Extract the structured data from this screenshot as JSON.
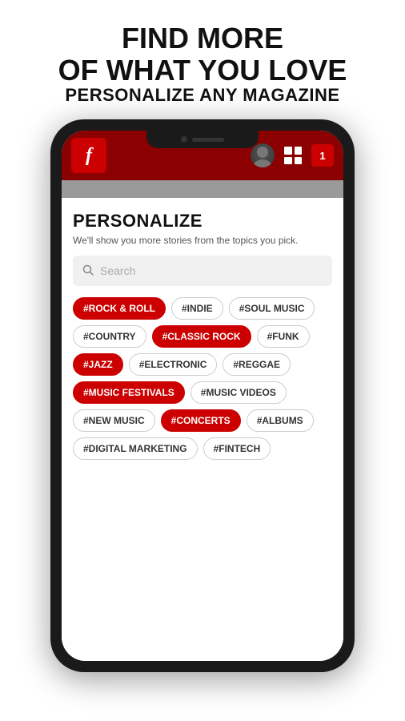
{
  "header": {
    "line1": "FIND MORE",
    "line2": "OF WHAT YOU LOVE",
    "line3": "PERSONALIZE ANY MAGAZINE"
  },
  "app": {
    "logo_letter": "f",
    "notification_count": "1"
  },
  "personalize": {
    "title": "PERSONALIZE",
    "subtitle": "We'll show you more stories from the topics you pick.",
    "search_placeholder": "Search"
  },
  "tags": [
    {
      "label": "#ROCK & ROLL",
      "active": true
    },
    {
      "label": "#INDIE",
      "active": false
    },
    {
      "label": "#SOUL MUSIC",
      "active": false
    },
    {
      "label": "#COUNTRY",
      "active": false
    },
    {
      "label": "#CLASSIC ROCK",
      "active": true
    },
    {
      "label": "#FUNK",
      "active": false
    },
    {
      "label": "#JAZZ",
      "active": true
    },
    {
      "label": "#ELECTRONIC",
      "active": false
    },
    {
      "label": "#REGGAE",
      "active": false
    },
    {
      "label": "#MUSIC FESTIVALS",
      "active": true
    },
    {
      "label": "#MUSIC VIDEOS",
      "active": false
    },
    {
      "label": "#NEW MUSIC",
      "active": false
    },
    {
      "label": "#CONCERTS",
      "active": true
    },
    {
      "label": "#ALBUMS",
      "active": false
    },
    {
      "label": "#DIGITAL MARKETING",
      "active": false
    },
    {
      "label": "#FINTECH",
      "active": false
    }
  ]
}
